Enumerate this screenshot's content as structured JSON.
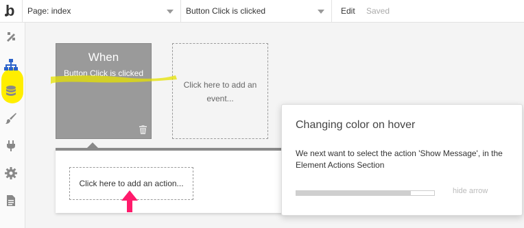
{
  "app": {
    "logo_letter": "b"
  },
  "toolbar": {
    "page_select": "Page: index",
    "event_select": "Button Click is clicked",
    "edit_label": "Edit",
    "save_status": "Saved"
  },
  "sidebar": {
    "items": [
      {
        "icon": "design-icon"
      },
      {
        "icon": "workflow-icon",
        "active": true
      },
      {
        "icon": "data-icon"
      },
      {
        "icon": "styles-icon"
      },
      {
        "icon": "plugins-icon"
      },
      {
        "icon": "settings-icon"
      },
      {
        "icon": "logs-icon"
      }
    ]
  },
  "workflow": {
    "event_card": {
      "when": "When",
      "event_name": "Button Click is clicked",
      "icon": "trash-icon"
    },
    "add_event": "Click here to add an event...",
    "add_action": "Click here to add an action..."
  },
  "popup": {
    "title": "Changing color on hover",
    "text": "We next want to select the action 'Show Message', in the Element Actions Section",
    "progress": 0.83,
    "hide_arrow": "hide arrow"
  },
  "colors": {
    "highlight": "#ffee00",
    "arrow": "#ff1a6b",
    "event_card": "#9a9a9a",
    "workflow_icon": "#2b62c9"
  }
}
